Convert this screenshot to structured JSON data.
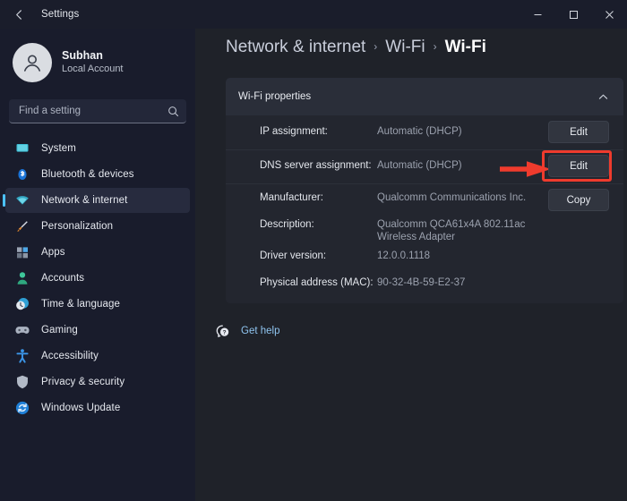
{
  "window": {
    "title": "Settings",
    "back_icon": "back-arrow-icon",
    "minimize_label": "Minimize",
    "maximize_label": "Maximize",
    "close_label": "Close"
  },
  "sidebar": {
    "profile": {
      "name": "Subhan",
      "account_type": "Local Account",
      "avatar_icon": "user-avatar-icon"
    },
    "search": {
      "placeholder": "Find a setting",
      "value": "",
      "icon": "search-icon"
    },
    "items": [
      {
        "label": "System",
        "icon": "monitor-icon",
        "active": false
      },
      {
        "label": "Bluetooth & devices",
        "icon": "bluetooth-icon",
        "active": false
      },
      {
        "label": "Network & internet",
        "icon": "wifi-icon",
        "active": true
      },
      {
        "label": "Personalization",
        "icon": "paintbrush-icon",
        "active": false
      },
      {
        "label": "Apps",
        "icon": "apps-grid-icon",
        "active": false
      },
      {
        "label": "Accounts",
        "icon": "accounts-person-icon",
        "active": false
      },
      {
        "label": "Time & language",
        "icon": "clock-globe-icon",
        "active": false
      },
      {
        "label": "Gaming",
        "icon": "game-controller-icon",
        "active": false
      },
      {
        "label": "Accessibility",
        "icon": "accessibility-person-icon",
        "active": false
      },
      {
        "label": "Privacy & security",
        "icon": "shield-icon",
        "active": false
      },
      {
        "label": "Windows Update",
        "icon": "update-refresh-icon",
        "active": false
      }
    ]
  },
  "main": {
    "breadcrumb": {
      "root": "Network & internet",
      "separator": "›",
      "middle": "Wi-Fi",
      "current": "Wi-Fi"
    },
    "card": {
      "title": "Wi-Fi properties",
      "collapse_icon": "chevron-up-icon",
      "rows": [
        {
          "label": "IP assignment:",
          "value": "Automatic (DHCP)",
          "action": "Edit",
          "highlighted": false
        },
        {
          "label": "DNS server assignment:",
          "value": "Automatic (DHCP)",
          "action": "Edit",
          "highlighted": true
        },
        {
          "label": "Manufacturer:",
          "value": "Qualcomm Communications Inc.",
          "action": "Copy",
          "highlighted": false
        },
        {
          "label": "Description:",
          "value": "Qualcomm QCA61x4A 802.11ac",
          "value2": "Wireless Adapter",
          "action": "",
          "highlighted": false
        },
        {
          "label": "Driver version:",
          "value": "12.0.0.1118",
          "action": "",
          "highlighted": false
        },
        {
          "label": "Physical address (MAC):",
          "value": "90-32-4B-59-E2-37",
          "action": "",
          "highlighted": false
        }
      ]
    },
    "get_help": {
      "label": "Get help",
      "icon": "help-question-icon"
    }
  },
  "annotation": {
    "arrow_color": "#ef3b2d",
    "highlight_color": "#ef3b2d",
    "target": "dns-server-assignment-edit-button"
  },
  "colors": {
    "accent": "#4cc2ff",
    "sidebar_bg": "#191c2c",
    "main_bg": "#1f2229",
    "card_bg": "#23262f",
    "card_head_bg": "#2a2e39",
    "link": "#8fc4ef"
  }
}
